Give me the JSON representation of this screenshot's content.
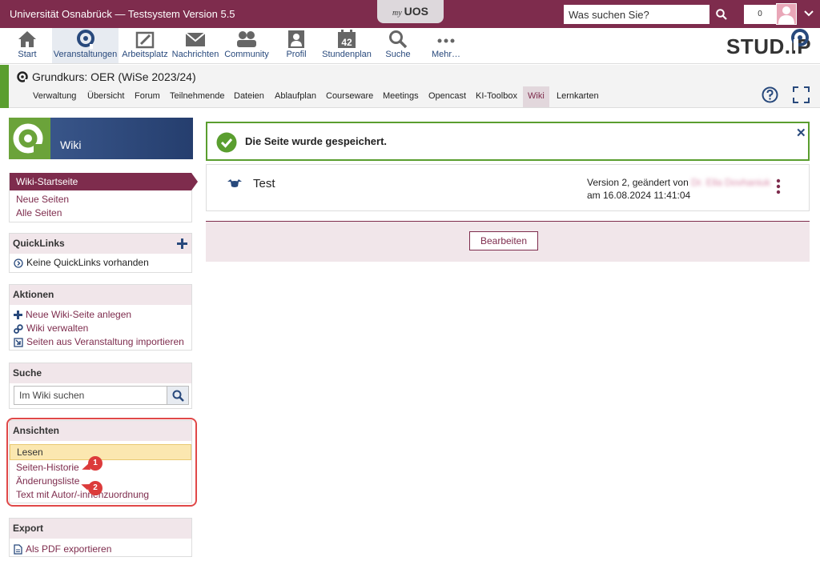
{
  "topbar": {
    "title": "Universität Osnabrück — Testsystem Version 5.5",
    "myuos_my": "my",
    "myuos_uos": "UOS",
    "search_placeholder": "Was suchen Sie?",
    "notification_count": "0"
  },
  "mainnav": {
    "items": [
      {
        "label": "Start",
        "icon": "home-icon"
      },
      {
        "label": "Veranstaltungen",
        "icon": "courses-icon"
      },
      {
        "label": "Arbeitsplatz",
        "icon": "workplace-icon"
      },
      {
        "label": "Nachrichten",
        "icon": "mail-icon"
      },
      {
        "label": "Community",
        "icon": "community-icon"
      },
      {
        "label": "Profil",
        "icon": "profile-icon"
      },
      {
        "label": "Stundenplan",
        "icon": "schedule-icon",
        "badge": "42"
      },
      {
        "label": "Suche",
        "icon": "search-icon"
      },
      {
        "label": "Mehr…",
        "icon": "more-icon"
      }
    ],
    "logo": "STUD.IP"
  },
  "course": {
    "title": "Grundkurs: OER (WiSe 2023/24)",
    "tabs": [
      "Verwaltung",
      "Übersicht",
      "Forum",
      "Teilnehmende",
      "Dateien",
      "Ablaufplan",
      "Courseware",
      "Meetings",
      "Opencast",
      "KI-Toolbox",
      "Wiki",
      "Lernkarten"
    ],
    "active_tab": "Wiki"
  },
  "sidebar": {
    "header": "Wiki",
    "navigation": {
      "active": "Wiki-Startseite",
      "items": [
        "Neue Seiten",
        "Alle Seiten"
      ]
    },
    "quicklinks": {
      "title": "QuickLinks",
      "empty": "Keine QuickLinks vorhanden"
    },
    "actions": {
      "title": "Aktionen",
      "items": [
        "Neue Wiki-Seite anlegen",
        "Wiki verwalten",
        "Seiten aus Veranstaltung importieren"
      ]
    },
    "search": {
      "title": "Suche",
      "placeholder": "Im Wiki suchen"
    },
    "views": {
      "title": "Ansichten",
      "active": "Lesen",
      "items": [
        "Seiten-Historie",
        "Änderungsliste",
        "Text mit Autor/-innenzuordnung"
      ]
    },
    "export": {
      "title": "Export",
      "item": "Als PDF exportieren"
    },
    "annotations": [
      "1",
      "2"
    ]
  },
  "main": {
    "message": "Die Seite wurde gespeichert.",
    "page_name": "Test",
    "version_prefix": "Version 2, geändert von",
    "author": "Dr. Ella Dovhaniuk",
    "version_date": "am 16.08.2024 11:41:04",
    "edit_button": "Bearbeiten"
  },
  "colors": {
    "brand": "#7e2c4d",
    "nav_blue": "#28497c",
    "success": "#5a9e2f",
    "annotation_red": "#dc3b3b"
  }
}
